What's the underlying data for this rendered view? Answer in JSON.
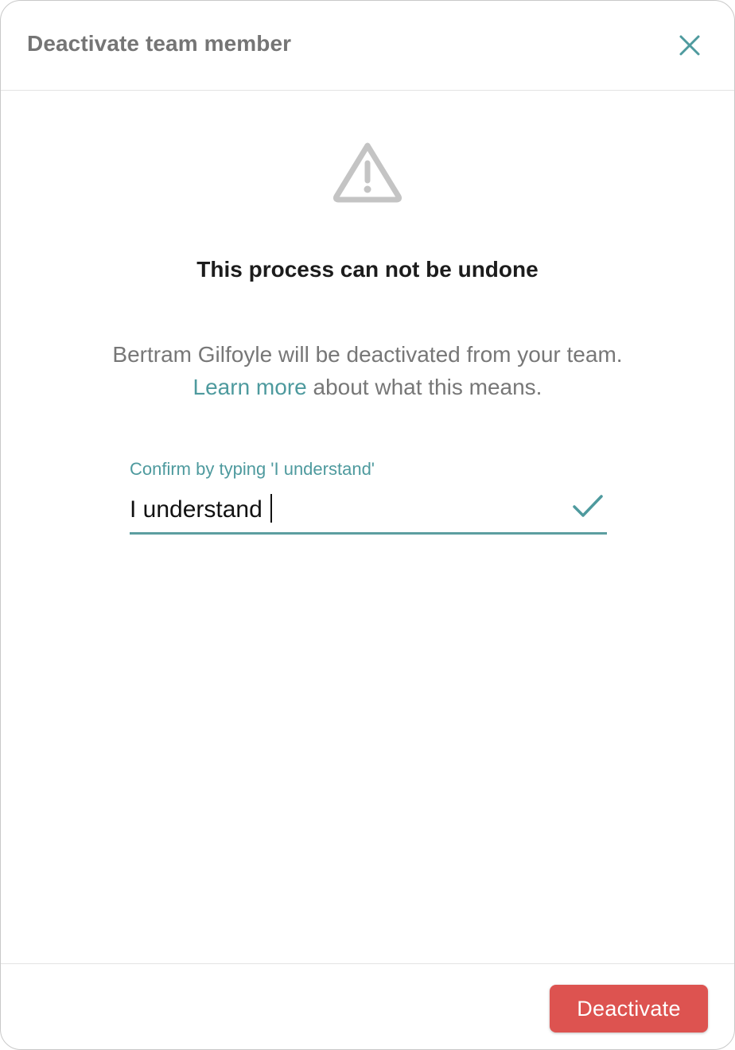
{
  "dialog": {
    "title": "Deactivate team member",
    "close_icon": "close-icon"
  },
  "warning": {
    "icon": "warning-triangle-icon",
    "heading": "This process can not be undone"
  },
  "description": {
    "line1": "Bertram Gilfoyle will be deactivated from your team.",
    "link_text": "Learn more",
    "line2_rest": " about what this means."
  },
  "confirm_field": {
    "label": "Confirm by typing 'I understand'",
    "value": "I understand",
    "valid_icon": "check-icon"
  },
  "footer": {
    "deactivate_label": "Deactivate"
  },
  "colors": {
    "accent": "#4e9a9e",
    "danger": "#dd5350",
    "muted_text": "#777777",
    "icon_gray": "#c4c4c4"
  }
}
